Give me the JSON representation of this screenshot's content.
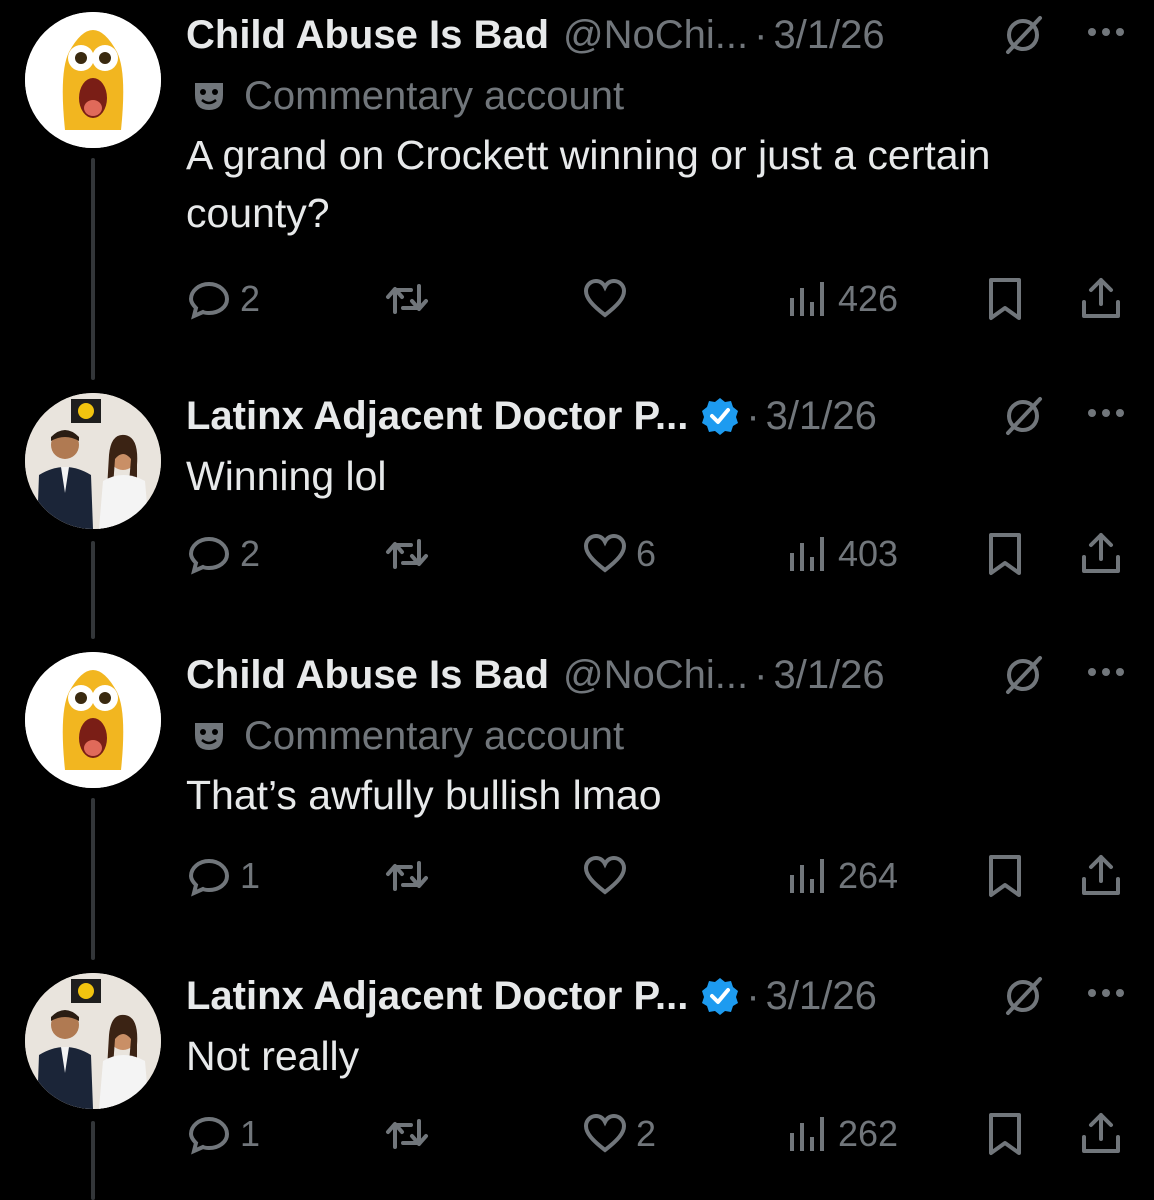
{
  "tweets": [
    {
      "name": "Child Abuse Is Bad",
      "handle": "@NoChi...",
      "date": "3/1/26",
      "verified": false,
      "label": "Commentary account",
      "text": "A grand on Crockett winning or just a certain county?",
      "replies": "2",
      "retweets": "",
      "likes": "",
      "views": "426"
    },
    {
      "name": "Latinx Adjacent Doctor P...",
      "handle": "",
      "date": "3/1/26",
      "verified": true,
      "label": "",
      "text": "Winning lol",
      "replies": "2",
      "retweets": "",
      "likes": "6",
      "views": "403"
    },
    {
      "name": "Child Abuse Is Bad",
      "handle": "@NoChi...",
      "date": "3/1/26",
      "verified": false,
      "label": "Commentary account",
      "text": "That’s awfully bullish lmao",
      "replies": "1",
      "retweets": "",
      "likes": "",
      "views": "264"
    },
    {
      "name": "Latinx Adjacent Doctor P...",
      "handle": "",
      "date": "3/1/26",
      "verified": true,
      "label": "",
      "text": "Not really",
      "replies": "1",
      "retweets": "",
      "likes": "2",
      "views": "262"
    }
  ],
  "separator": "·",
  "icons": {
    "reply": "reply-icon",
    "retweet": "retweet-icon",
    "like": "heart-icon",
    "views": "views-icon",
    "bookmark": "bookmark-icon",
    "share": "share-icon",
    "grok": "grok-icon",
    "more": "more-icon",
    "label": "theater-mask-icon",
    "verified": "verified-badge-icon"
  },
  "colors": {
    "background": "#000000",
    "text": "#e7e9ea",
    "muted": "#71767b",
    "verified": "#1d9bf0",
    "line": "#333639"
  }
}
